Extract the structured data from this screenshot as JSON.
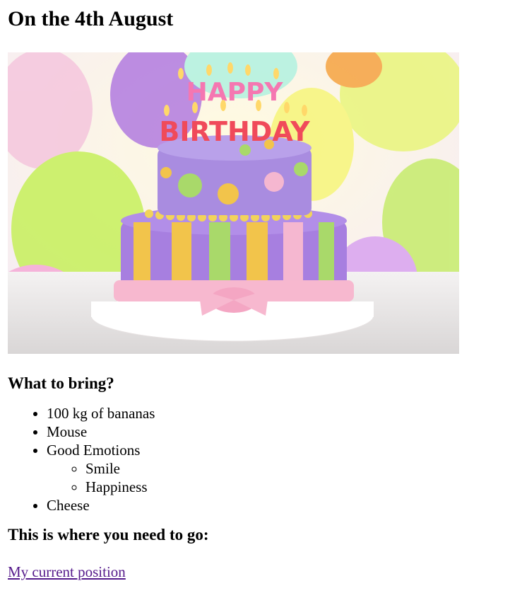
{
  "page": {
    "title": "On the 4th August"
  },
  "hero_image": {
    "alt": "Birthday cake",
    "candle_text_top": "HAPPY",
    "candle_text_bottom": "BIRTHDAY"
  },
  "bring_section": {
    "heading": "What to bring?",
    "items": [
      {
        "label": "100 kg of bananas"
      },
      {
        "label": "Mouse"
      },
      {
        "label": "Good Emotions",
        "subitems": [
          {
            "label": "Smile"
          },
          {
            "label": "Happiness"
          }
        ]
      },
      {
        "label": "Cheese"
      }
    ]
  },
  "location_section": {
    "heading": "This is where you need to go:",
    "link_text": "My current position"
  },
  "colors": {
    "link_visited": "#551a8b"
  }
}
